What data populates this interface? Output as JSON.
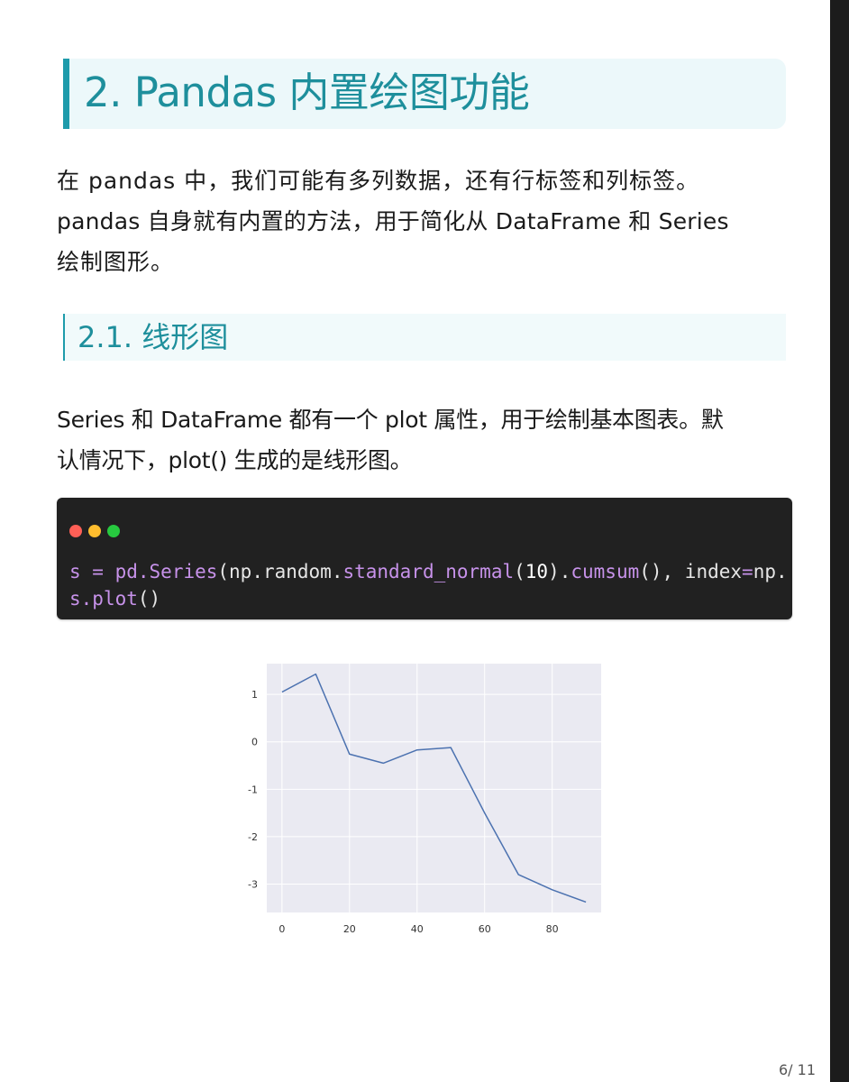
{
  "heading": "2. Pandas 内置绘图功能",
  "intro_lines": [
    "在 pandas 中，我们可能有多列数据，还有行标签和列标签。",
    "pandas 自身就有内置的方法，用于简化从 DataFrame 和 Series",
    "绘制图形。"
  ],
  "subheading": "2.1. 线形图",
  "body_lines": [
    "Series 和 DataFrame 都有一个 plot 属性，用于绘制基本图表。默",
    "认情况下，plot() 生成的是线形图。"
  ],
  "code": {
    "line1": {
      "t1": "s ",
      "t2": "=",
      "t3": " pd.",
      "t4": "Series",
      "t5": "(np.random.",
      "t6": "standard_normal",
      "t7": "(",
      "t8": "10",
      "t9": ").",
      "t10": "cumsum",
      "t11": "(), index",
      "t12": "=",
      "t13": "np."
    },
    "line2": {
      "t1": "s.",
      "t2": "plot",
      "t3": "()"
    }
  },
  "chart_data": {
    "type": "line",
    "x": [
      0,
      10,
      20,
      30,
      40,
      50,
      60,
      70,
      80,
      90
    ],
    "y": [
      1.05,
      1.43,
      -0.26,
      -0.45,
      -0.17,
      -0.12,
      -1.5,
      -2.8,
      -3.12,
      -3.38
    ],
    "xticks": [
      "0",
      "20",
      "40",
      "60",
      "80"
    ],
    "yticks": [
      "1",
      "0",
      "-1",
      "-2",
      "-3"
    ],
    "xlim": [
      -4.5,
      94.5
    ],
    "ylim": [
      -3.6,
      1.65
    ],
    "grid": true,
    "colors": {
      "line": "#4c72b0",
      "background": "#eaeaf2",
      "grid": "#ffffff"
    }
  },
  "footer": {
    "page": "6/ 11"
  }
}
